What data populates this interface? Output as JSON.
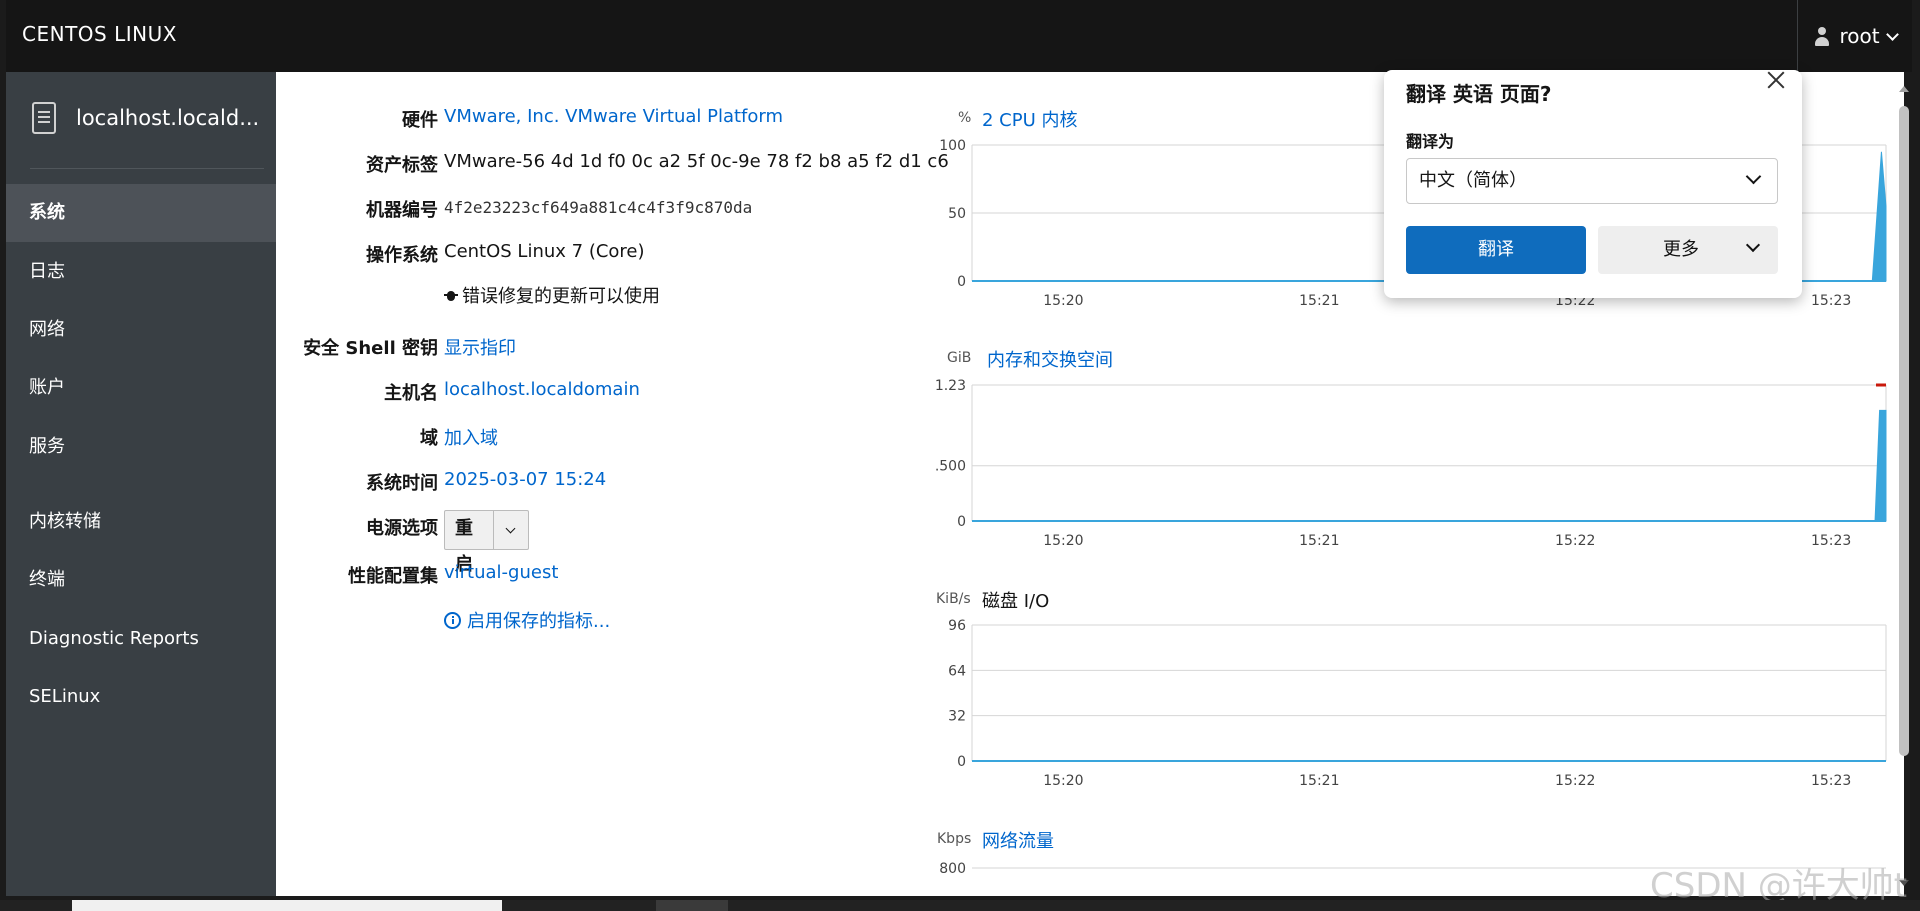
{
  "topbar": {
    "brand": "CENTOS LINUX",
    "user": "root"
  },
  "sidebar": {
    "host": "localhost.locald...",
    "items": [
      {
        "label": "系统",
        "active": true
      },
      {
        "label": "日志",
        "active": false
      },
      {
        "label": "网络",
        "active": false
      },
      {
        "label": "账户",
        "active": false
      },
      {
        "label": "服务",
        "active": false
      },
      {
        "label": "内核转储",
        "active": false
      },
      {
        "label": "终端",
        "active": false
      },
      {
        "label": "Diagnostic Reports",
        "active": false
      },
      {
        "label": "SELinux",
        "active": false
      }
    ]
  },
  "system": {
    "hardware_label": "硬件",
    "hardware_value": "VMware, Inc. VMware Virtual Platform",
    "asset_label": "资产标签",
    "asset_value": "VMware-56 4d 1d f0 0c a2 5f 0c-9e 78 f2 b8 a5 f2 d1 c6",
    "machine_id_label": "机器编号",
    "machine_id_value": "4f2e23223cf649a881c4c4f3f9c870da",
    "os_label": "操作系统",
    "os_value": "CentOS Linux 7 (Core)",
    "updates_text": "错误修复的更新可以使用",
    "ssh_label": "安全 Shell 密钥",
    "ssh_value": "显示指印",
    "hostname_label": "主机名",
    "hostname_value": "localhost.localdomain",
    "domain_label": "域",
    "domain_value": "加入域",
    "time_label": "系统时间",
    "time_value": "2025-03-07 15:24",
    "power_label": "电源选项",
    "power_button": "重启",
    "profile_label": "性能配置集",
    "profile_value": "virtual-guest",
    "metrics_link": "启用保存的指标..."
  },
  "charts": {
    "cpu": {
      "unit": "%",
      "title": "2 CPU 内核"
    },
    "memory": {
      "unit": "GiB",
      "title": "内存和交换空间"
    },
    "disk": {
      "unit": "KiB/s",
      "title": "磁盘 I/O"
    },
    "network": {
      "unit": "Kbps",
      "title": "网络流量"
    }
  },
  "chart_data": [
    {
      "type": "area",
      "title": "2 CPU 内核",
      "ylabel": "%",
      "ylim": [
        0,
        100
      ],
      "yticks": [
        "100",
        "50",
        "0"
      ],
      "xticks": [
        "15:20",
        "15:21",
        "15:22",
        "15:23"
      ],
      "series": [
        {
          "values": [
            [
              0,
              0
            ],
            [
              0.985,
              0
            ],
            [
              0.995,
              95
            ],
            [
              1,
              55
            ]
          ]
        }
      ]
    },
    {
      "type": "area",
      "title": "内存和交换空间",
      "ylabel": "GiB",
      "ylim": [
        0,
        1.23
      ],
      "yticks": [
        "1.23",
        "0.500",
        "0"
      ],
      "xticks": [
        "15:20",
        "15:21",
        "15:22",
        "15:23"
      ],
      "series": [
        {
          "values": [
            [
              0,
              0
            ],
            [
              0.988,
              0
            ],
            [
              0.993,
              1.0
            ],
            [
              1,
              1.0
            ]
          ]
        }
      ]
    },
    {
      "type": "area",
      "title": "磁盘 I/O",
      "ylabel": "KiB/s",
      "ylim": [
        0,
        96
      ],
      "yticks": [
        "96",
        "64",
        "32",
        "0"
      ],
      "xticks": [
        "15:20",
        "15:21",
        "15:22",
        "15:23"
      ],
      "series": [
        {
          "values": [
            [
              0,
              0
            ],
            [
              1,
              0
            ]
          ]
        }
      ]
    },
    {
      "type": "area",
      "title": "网络流量",
      "ylabel": "Kbps",
      "yticks": [
        "800"
      ],
      "series": []
    }
  ],
  "popup": {
    "title": "翻译 英语 页面?",
    "label": "翻译为",
    "selected_language": "中文（简体）",
    "translate_button": "翻译",
    "more_button": "更多"
  },
  "watermark": "CSDN @许大帅t",
  "colors": {
    "accent": "#0066cc",
    "chart_fill": "#39a5dc",
    "sidebar": "#393f44",
    "topbar": "#151515",
    "translate_button": "#0f6cbd"
  }
}
